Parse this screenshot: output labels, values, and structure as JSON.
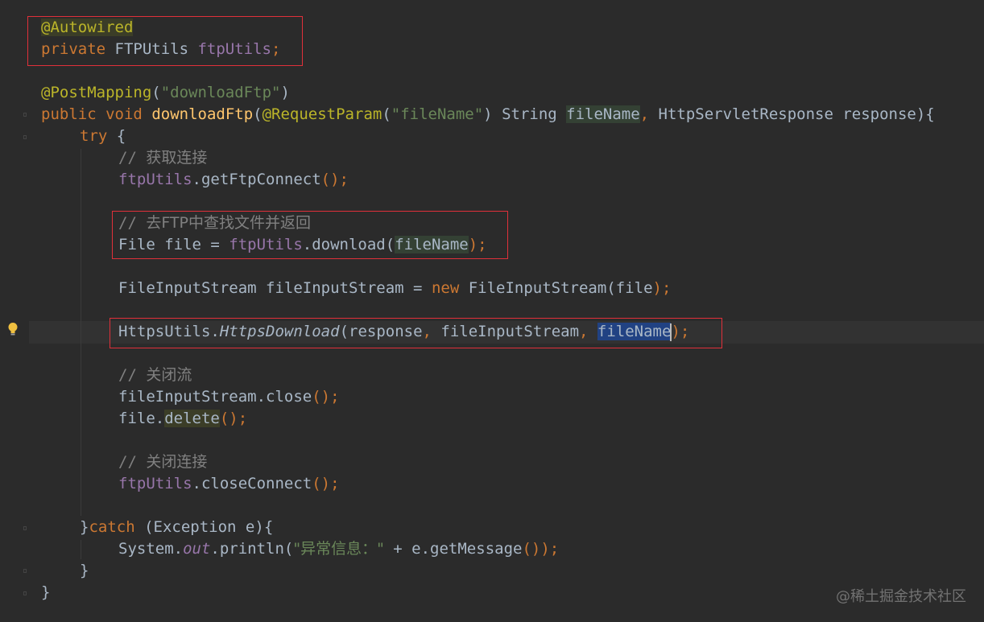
{
  "editor": {
    "language": "Java",
    "theme_colors": {
      "background": "#2b2b2b",
      "keyword": "#cc7832",
      "annotation": "#bbb529",
      "string": "#6a8759",
      "method": "#ffc66d",
      "field": "#9876aa",
      "comment": "#808080",
      "highlight_box": "#e0303a"
    },
    "gutter_icon": "lightbulb-icon",
    "tokens": {
      "autowired": "@Autowired",
      "private": "private",
      "ftputils_type": " FTPUtils ",
      "ftputils_field": "ftpUtils",
      "semi": ";",
      "postmapping": "@PostMapping",
      "lparen": "(",
      "rparen": ")",
      "download_ftp_str": "\"downloadFtp\"",
      "public": "public",
      "void": "void",
      "space": " ",
      "download_ftp_fn": "downloadFtp",
      "request_param": "@RequestParam",
      "file_name_str": "\"fileName\"",
      "string_type": " String ",
      "file_name_param": "fileName",
      "comma": ",",
      "http_resp": " HttpServletResponse response",
      "close_sig": "){",
      "try": "try",
      "open_brace": " {",
      "comment_slash": "// ",
      "comment_connect": "获取连接",
      "get_ftp_connect": ".getFtpConnect",
      "call_end": "();",
      "comment_find": "去FTP中查找文件并返回",
      "file_decl": "File file = ",
      "download_call": ".download",
      "fis_decl": "FileInputStream fileInputStream = ",
      "new": "new",
      "fis_ctor": " FileInputStream",
      "file_arg": "file",
      "call_close": ");",
      "https_utils": "HttpsUtils.",
      "https_download": "HttpsDownload",
      "response_arg": "response",
      "fis_arg": " fileInputStream",
      "file_name_sel": "fileName",
      "comment_close_stream": "关闭流",
      "fis_close": "fileInputStream.close",
      "file_dot": "file.",
      "delete": "delete",
      "comment_close_conn": "关闭连接",
      "close_connect": ".closeConnect",
      "close_brace": "}",
      "catch": "catch",
      "exception_decl": " (Exception e)",
      "open_brace_tight": "{",
      "system": "System.",
      "out": "out",
      "println": ".println",
      "error_str": "\"异常信息：\"",
      "get_message": " + e.getMessage",
      "println_end": "());"
    }
  },
  "watermark": "@稀土掘金技术社区"
}
